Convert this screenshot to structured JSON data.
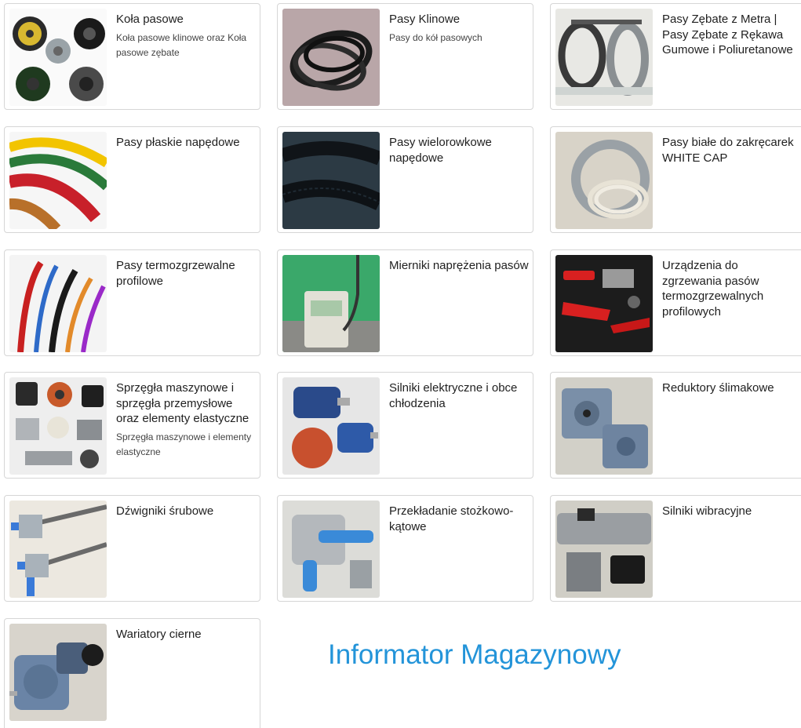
{
  "categories": [
    {
      "title": "Koła pasowe",
      "desc": "Koła pasowe klinowe oraz Koła pasowe zębate",
      "icon": "pulley-wheels-icon"
    },
    {
      "title": "Pasy Klinowe",
      "desc": "Pasy do kół pasowych",
      "icon": "v-belts-icon"
    },
    {
      "title": "Pasy Zębate z Metra | Pasy Zębate z Rękawa Gumowe i Poliuretanowe",
      "desc": "",
      "icon": "timing-belts-icon"
    },
    {
      "title": "Pasy płaskie napędowe",
      "desc": "",
      "icon": "flat-belts-icon"
    },
    {
      "title": "Pasy wielorowkowe napędowe",
      "desc": "",
      "icon": "multi-groove-belt-icon"
    },
    {
      "title": "Pasy białe do zakręcarek WHITE CAP",
      "desc": "",
      "icon": "white-belts-icon"
    },
    {
      "title": "Pasy termozgrzewalne profilowe",
      "desc": "",
      "icon": "thermo-belts-icon"
    },
    {
      "title": "Mierniki naprężenia pasów",
      "desc": "",
      "icon": "tension-meter-icon"
    },
    {
      "title": "Urządzenia do zgrzewania pasów termozgrzewalnych profilowych",
      "desc": "",
      "icon": "welding-tool-icon"
    },
    {
      "title": "Sprzęgła maszynowe i sprzęgła przemysłowe oraz elementy elastyczne",
      "desc": "Sprzęgła maszynowe i elementy elastyczne",
      "icon": "couplings-icon"
    },
    {
      "title": "Silniki elektryczne i obce chłodzenia",
      "desc": "",
      "icon": "electric-motor-icon"
    },
    {
      "title": "Reduktory ślimakowe",
      "desc": "",
      "icon": "worm-gearbox-icon"
    },
    {
      "title": "Dźwigniki śrubowe",
      "desc": "",
      "icon": "screw-jack-icon"
    },
    {
      "title": "Przekładanie stożkowo-kątowe",
      "desc": "",
      "icon": "bevel-gearbox-icon"
    },
    {
      "title": "Silniki wibracyjne",
      "desc": "",
      "icon": "vibration-motor-icon"
    },
    {
      "title": "Wariatory cierne",
      "desc": "",
      "icon": "friction-variator-icon"
    }
  ],
  "footer": {
    "brand": "Informator Magazynowy"
  }
}
